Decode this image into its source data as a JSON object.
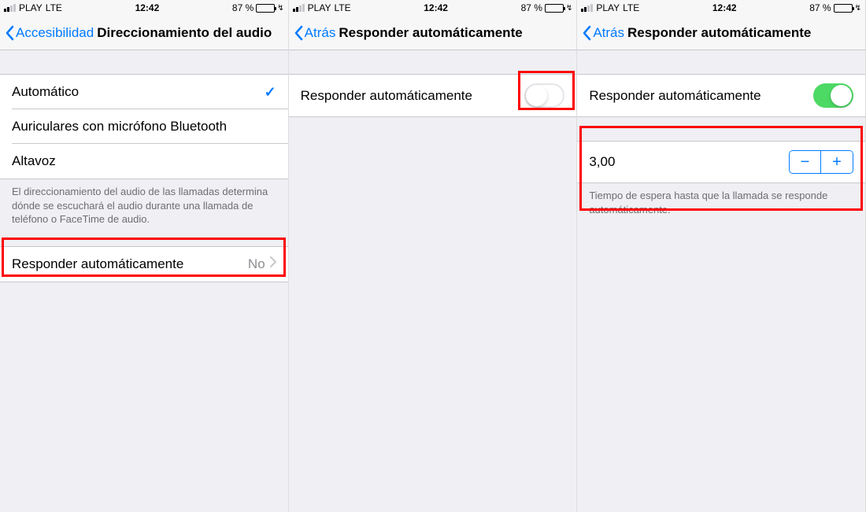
{
  "statusBar": {
    "carrier": "PLAY",
    "network": "LTE",
    "time": "12:42",
    "batteryPercent": "87 %"
  },
  "screen1": {
    "back": "Accesibilidad",
    "title": "Direccionamiento del audio",
    "items": [
      "Automático",
      "Auriculares con micrófono Bluetooth",
      "Altavoz"
    ],
    "selectedIndex": 0,
    "footer": "El direccionamiento del audio de las llamadas determina dónde se escuchará el audio durante una llamada de teléfono o FaceTime de audio.",
    "autoAnswer": {
      "label": "Responder automáticamente",
      "value": "No"
    }
  },
  "screen2": {
    "back": "Atrás",
    "title": "Responder automáticamente",
    "row": {
      "label": "Responder automáticamente",
      "state": "off"
    }
  },
  "screen3": {
    "back": "Atrás",
    "title": "Responder automáticamente",
    "row": {
      "label": "Responder automáticamente",
      "state": "on"
    },
    "durationValue": "3,00",
    "durationFooter": "Tiempo de espera hasta que la llamada se responde automáticamente."
  },
  "icons": {
    "minus": "−",
    "plus": "+",
    "bolt": "↯",
    "check": "✓"
  }
}
